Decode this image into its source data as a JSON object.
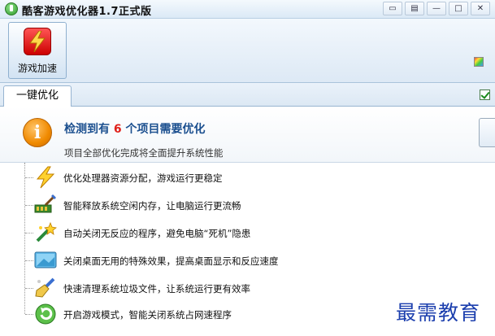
{
  "window": {
    "title": "酷客游戏优化器1.7正式版",
    "controls": [
      "▭",
      "▤",
      "—",
      "□",
      "✕"
    ]
  },
  "toolbar": {
    "accelerate_label": "游戏加速"
  },
  "tabs": [
    {
      "label": "一键优化",
      "active": true
    }
  ],
  "summary": {
    "headline_prefix": "检测到有",
    "count": "6",
    "headline_suffix": "个项目需要优化",
    "subtext": "项目全部优化完成将全面提升系统性能"
  },
  "items": [
    {
      "icon": "lightning-icon",
      "text": "优化处理器资源分配，游戏运行更稳定"
    },
    {
      "icon": "memory-brush-icon",
      "text": "智能释放系统空闲内存，让电脑运行更流畅"
    },
    {
      "icon": "wand-icon",
      "text": "自动关闭无反应的程序，避免电脑“死机”隐患"
    },
    {
      "icon": "desktop-icon",
      "text": "关闭桌面无用的特殊效果，提高桌面显示和反应速度"
    },
    {
      "icon": "broom-icon",
      "text": "快速清理系统垃圾文件，让系统运行更有效率"
    },
    {
      "icon": "refresh-icon",
      "text": "开启游戏模式，智能关闭系统占网速程序"
    }
  ],
  "watermark": "最需教育",
  "colors": {
    "accent_blue": "#1b4f8f",
    "count_red": "#e0201a",
    "titlebar": "#dbe9f6"
  }
}
